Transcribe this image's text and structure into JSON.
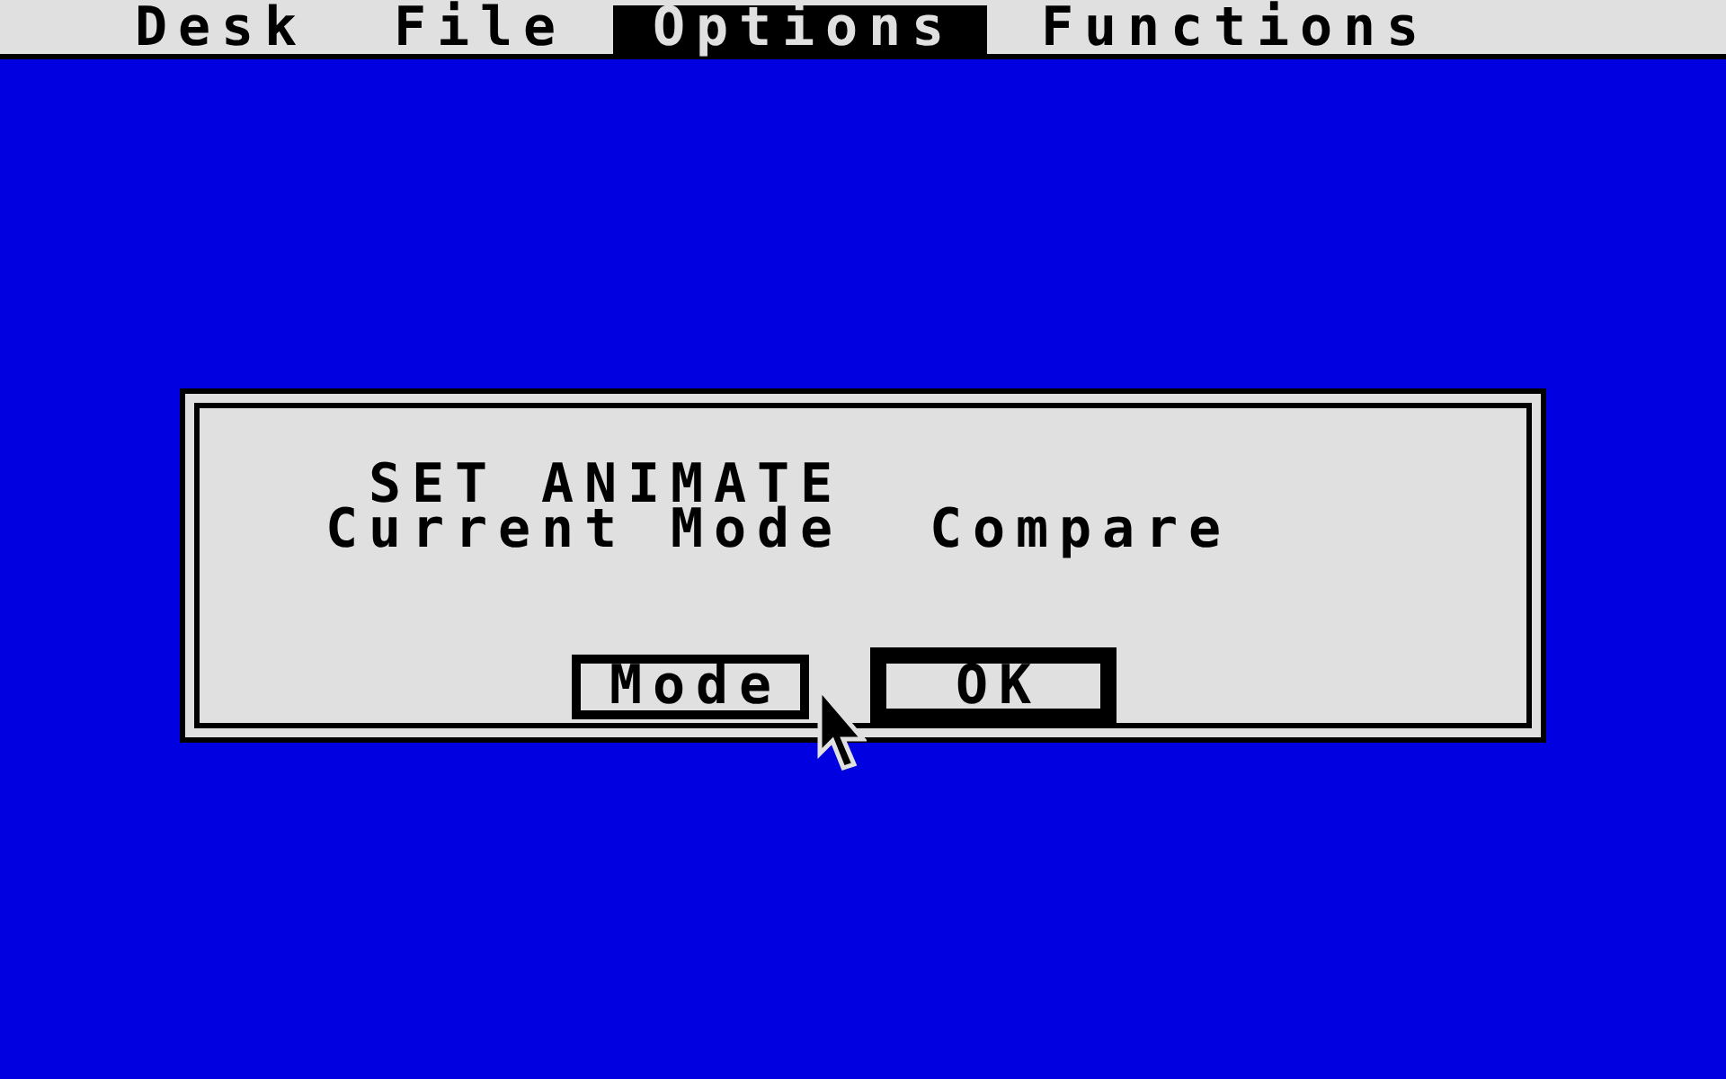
{
  "menu_bar": {
    "items": [
      {
        "label": "Desk",
        "selected": false
      },
      {
        "label": "File",
        "selected": false
      },
      {
        "label": "Options",
        "selected": true
      },
      {
        "label": "Functions",
        "selected": false
      }
    ]
  },
  "dialog": {
    "title": "SET ANIMATE",
    "field": {
      "label": "Current Mode",
      "value": "Compare"
    },
    "buttons": [
      {
        "label": "Mode",
        "default": false
      },
      {
        "label": "OK",
        "default": true
      }
    ]
  }
}
